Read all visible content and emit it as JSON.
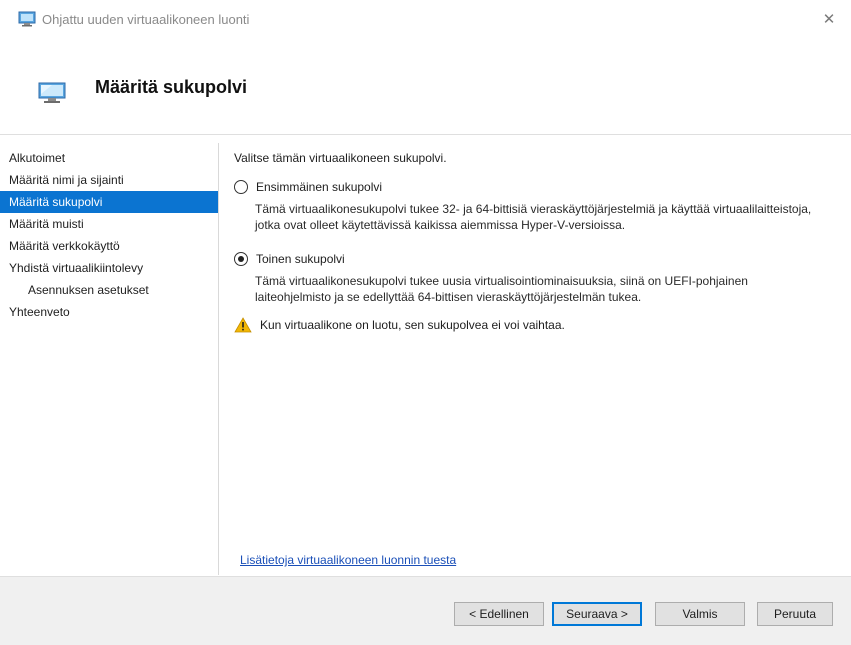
{
  "window": {
    "title": "Ohjattu uuden virtuaalikoneen luonti",
    "close_glyph": "✕",
    "icon": "computer-monitor-icon"
  },
  "header": {
    "title": "Määritä sukupolvi",
    "icon": "computer-monitor-icon"
  },
  "sidebar": {
    "items": [
      {
        "label": "Alkutoimet",
        "active": false,
        "sub": false
      },
      {
        "label": "Määritä nimi ja sijainti",
        "active": false,
        "sub": false
      },
      {
        "label": "Määritä sukupolvi",
        "active": true,
        "sub": false
      },
      {
        "label": "Määritä muisti",
        "active": false,
        "sub": false
      },
      {
        "label": "Määritä verkkokäyttö",
        "active": false,
        "sub": false
      },
      {
        "label": "Yhdistä virtuaalikiintolevy",
        "active": false,
        "sub": false
      },
      {
        "label": "Asennuksen asetukset",
        "active": false,
        "sub": true
      },
      {
        "label": "Yhteenveto",
        "active": false,
        "sub": false
      }
    ]
  },
  "main": {
    "intro": "Valitse tämän virtuaalikoneen sukupolvi.",
    "option1": {
      "label": "Ensimmäinen sukupolvi",
      "checked": false,
      "description": "Tämä virtuaalikonesukupolvi tukee 32- ja 64-bittisiä vieraskäyttöjärjestelmiä ja käyttää virtuaalilaitteistoja, jotka ovat olleet käytettävissä kaikissa aiemmissa Hyper-V-versioissa."
    },
    "option2": {
      "label": "Toinen sukupolvi",
      "checked": true,
      "description": "Tämä virtuaalikonesukupolvi tukee uusia virtualisointiominaisuuksia, siinä on UEFI-pohjainen laiteohjelmisto ja se edellyttää 64-bittisen vieraskäyttöjärjestelmän tukea."
    },
    "warning": "Kun virtuaalikone on luotu, sen sukupolvea ei voi vaihtaa.",
    "help_link": "Lisätietoja virtuaalikoneen luonnin tuesta"
  },
  "footer": {
    "previous": "< Edellinen",
    "next": "Seuraava >",
    "finish": "Valmis",
    "cancel": "Peruuta"
  },
  "colors": {
    "accent": "#0b74d1",
    "warning": "#f2b705",
    "link": "#1a4fb8"
  }
}
